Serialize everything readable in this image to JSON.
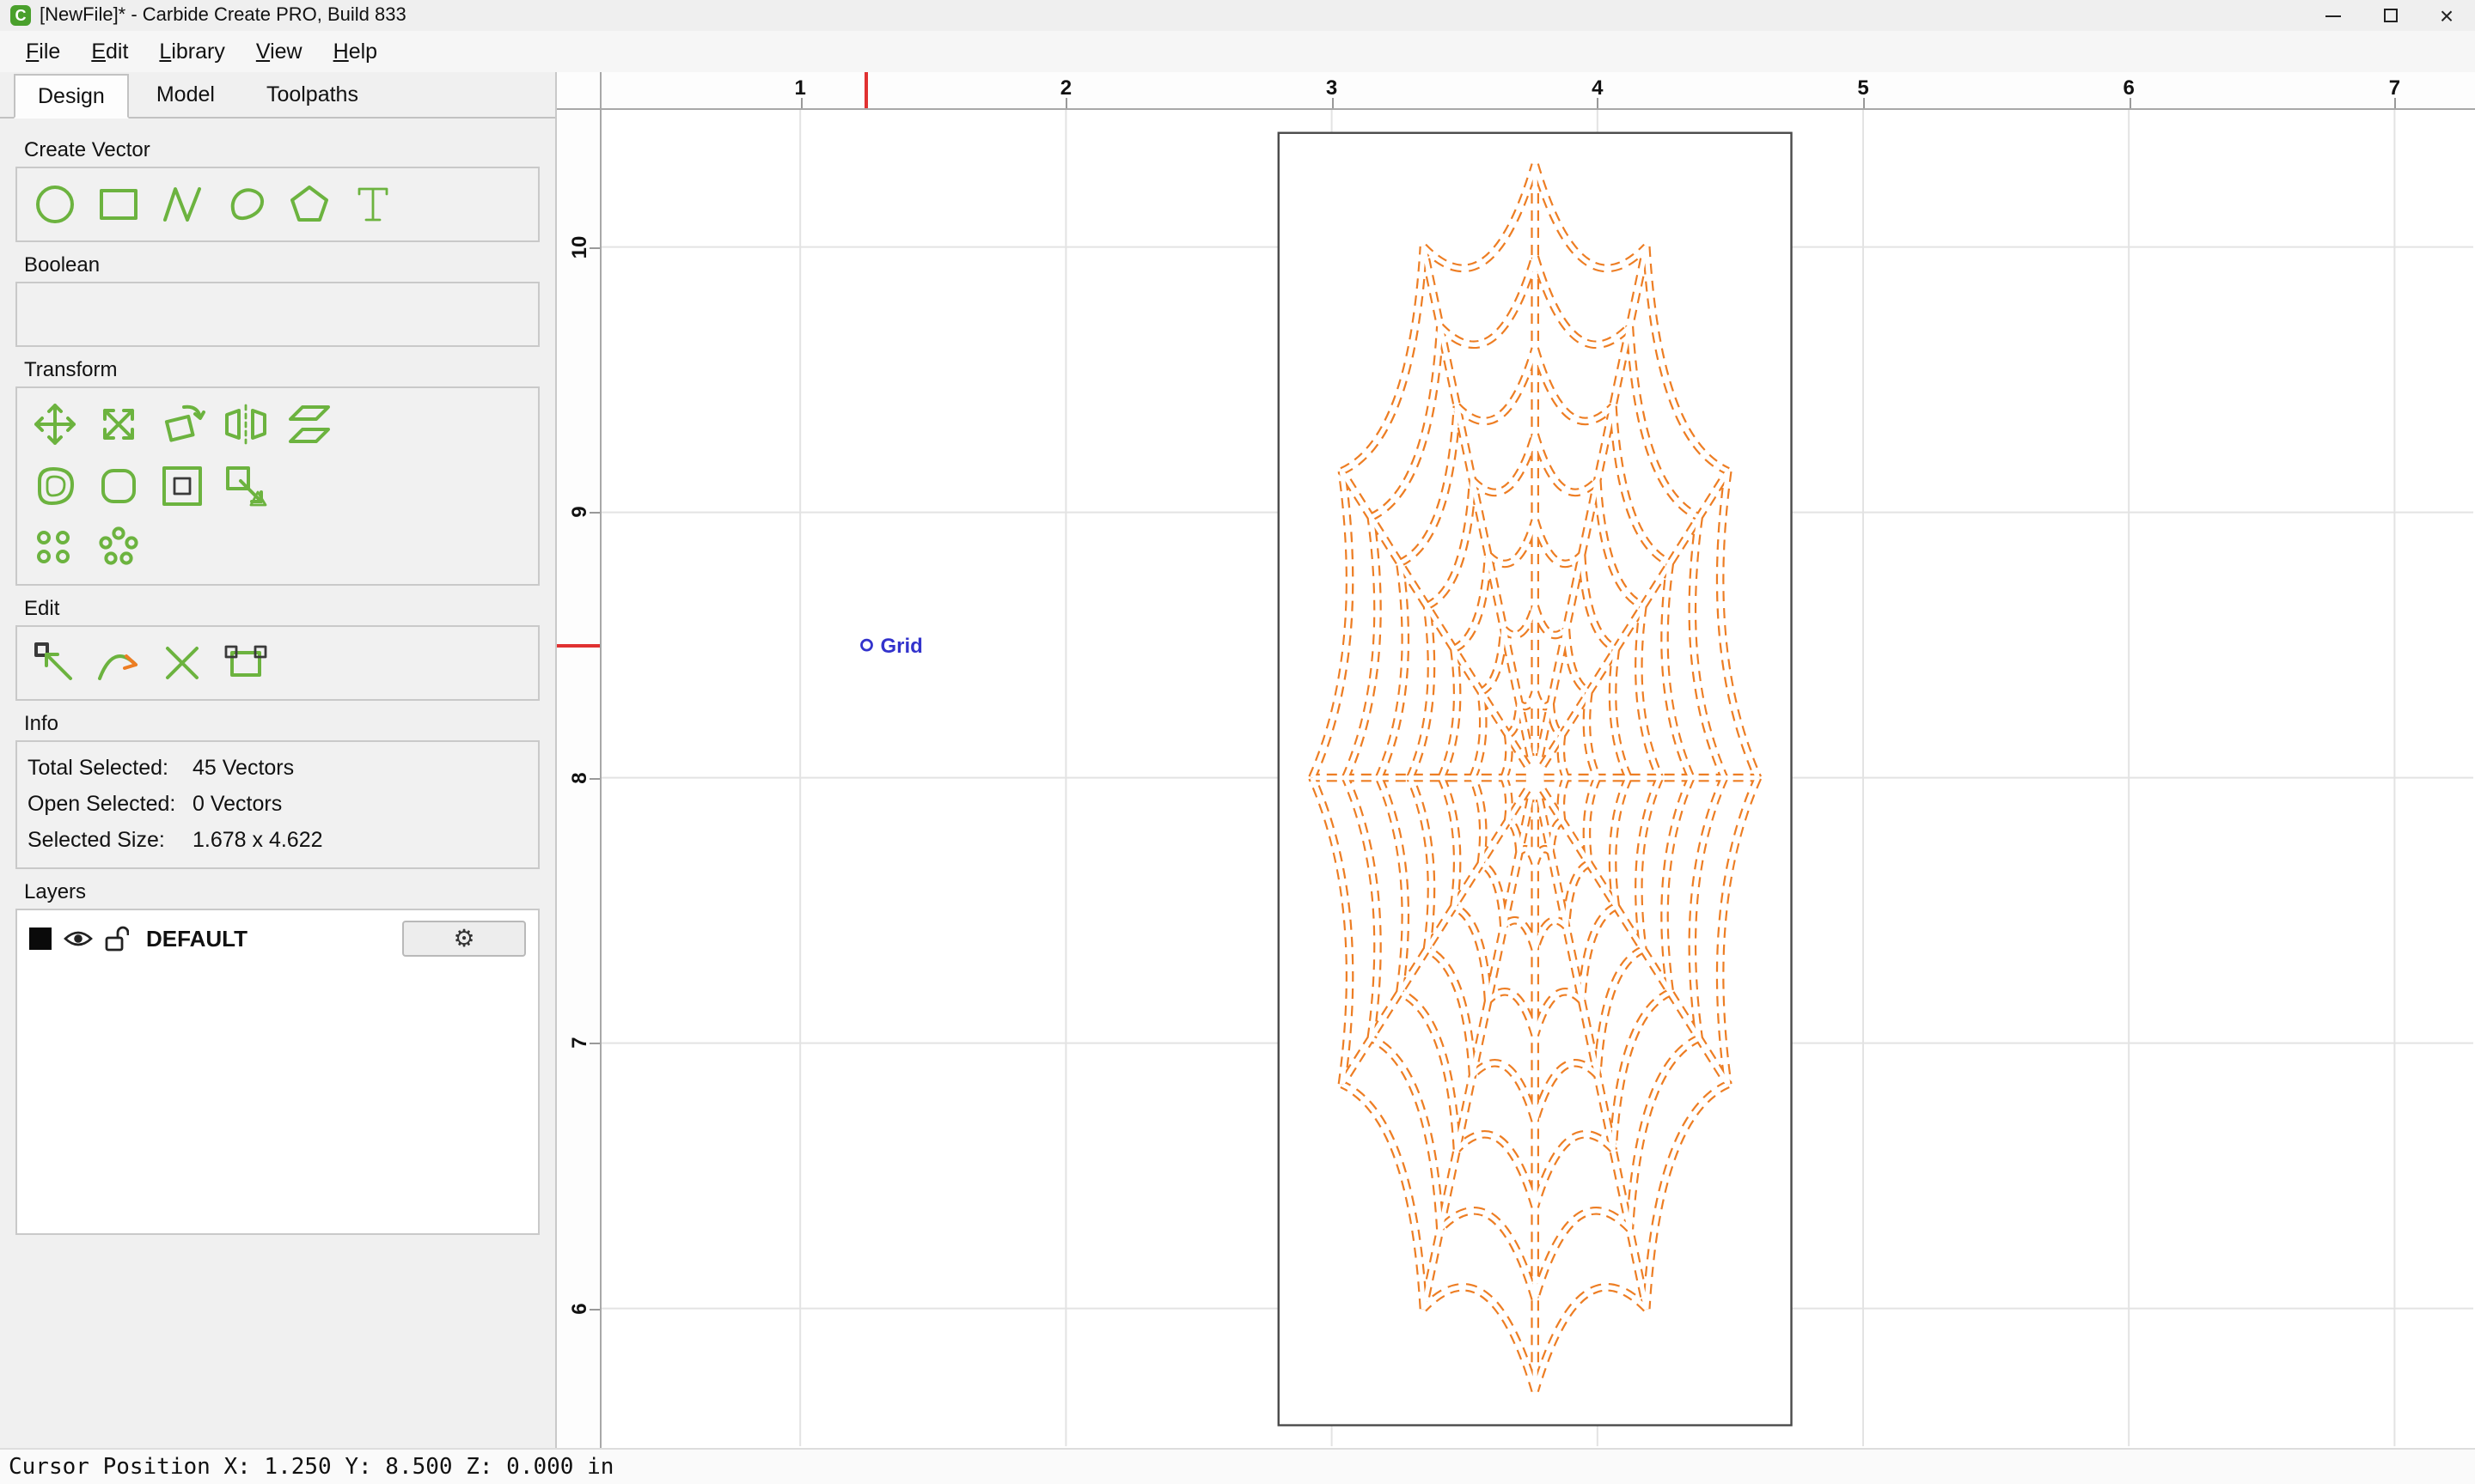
{
  "window": {
    "title": "[NewFile]* - Carbide Create PRO, Build 833"
  },
  "icons": {
    "app": "C",
    "gear": "⚙",
    "close": "×"
  },
  "menu": {
    "items": [
      "File",
      "Edit",
      "Library",
      "View",
      "Help"
    ]
  },
  "tabs": {
    "items": [
      "Design",
      "Model",
      "Toolpaths"
    ],
    "active": "Design"
  },
  "sidebar": {
    "create_vector": {
      "title": "Create Vector"
    },
    "boolean": {
      "title": "Boolean"
    },
    "transform": {
      "title": "Transform"
    },
    "edit": {
      "title": "Edit"
    },
    "info": {
      "title": "Info",
      "rows": [
        {
          "label": "Total Selected:",
          "value": "45 Vectors"
        },
        {
          "label": "Open Selected:",
          "value": "0 Vectors"
        },
        {
          "label": "Selected Size:",
          "value": "1.678 x 4.622"
        }
      ]
    },
    "layers": {
      "title": "Layers",
      "layer": {
        "name": "DEFAULT"
      }
    }
  },
  "canvas": {
    "ruler_h": [
      "1",
      "2",
      "3",
      "4",
      "5",
      "6",
      "7"
    ],
    "ruler_v": [
      "10",
      "9",
      "8",
      "7",
      "6"
    ],
    "snap_label": "Grid",
    "cursor": {
      "x_in": 1.25,
      "y_in": 8.5
    }
  },
  "artwork": {
    "stock": {
      "x1_in": 2.8,
      "x2_in": 4.73,
      "y1_in": 5.56,
      "y2_in": 10.43
    },
    "web": {
      "type": "spider-web",
      "center_x_in": 3.765,
      "center_y_in": 8.0,
      "width_in": 1.678,
      "height_in": 4.622,
      "spokes": 12,
      "rings": [
        0.14,
        0.28,
        0.42,
        0.56,
        0.7,
        0.85,
        1.0
      ],
      "pull": 0.78
    }
  },
  "statusbar": {
    "text": "Cursor Position X: 1.250 Y: 8.500 Z: 0.000 in"
  },
  "colors": {
    "accent_green": "#6cb33f",
    "selection_orange": "#ed7d23",
    "snap_blue": "#3333cc",
    "cursor_red": "#e03131",
    "layer_swatch": "#000000"
  }
}
